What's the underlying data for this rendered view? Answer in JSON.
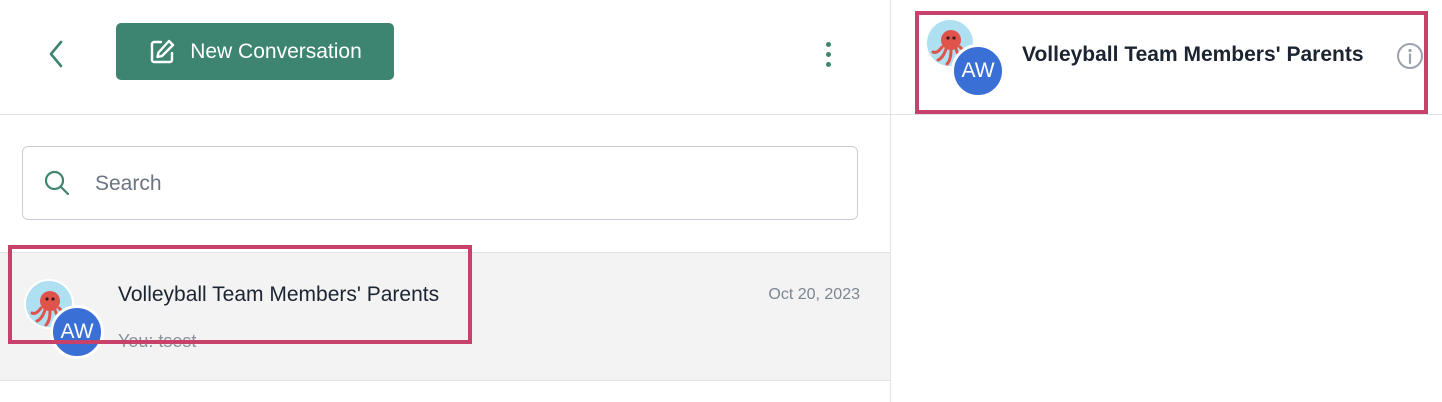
{
  "header": {
    "new_conversation_label": "New Conversation"
  },
  "search": {
    "placeholder": "Search",
    "value": ""
  },
  "conversations": [
    {
      "title": "Volleyball Team Members' Parents",
      "date": "Oct 20, 2023",
      "preview": "You:  tsest",
      "avatar_initials": "AW"
    }
  ],
  "active_conversation": {
    "title": "Volleyball Team Members' Parents",
    "avatar_initials": "AW"
  },
  "colors": {
    "accent": "#3d8570",
    "avatar_blue": "#3a6fd6",
    "highlight": "#c8416b",
    "selected_row": "#f3f3f3"
  },
  "icons": [
    "back-chevron-icon",
    "edit-icon",
    "kebab-menu-icon",
    "search-icon",
    "octopus-avatar-icon",
    "info-icon"
  ]
}
